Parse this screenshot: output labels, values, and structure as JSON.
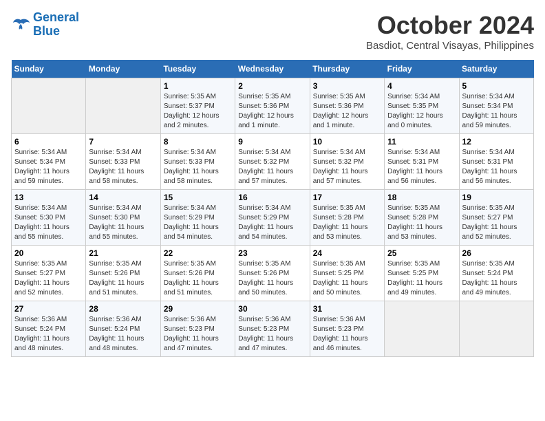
{
  "logo": {
    "text1": "General",
    "text2": "Blue"
  },
  "title": "October 2024",
  "location": "Basdiot, Central Visayas, Philippines",
  "headers": [
    "Sunday",
    "Monday",
    "Tuesday",
    "Wednesday",
    "Thursday",
    "Friday",
    "Saturday"
  ],
  "weeks": [
    [
      {
        "day": "",
        "info": ""
      },
      {
        "day": "",
        "info": ""
      },
      {
        "day": "1",
        "info": "Sunrise: 5:35 AM\nSunset: 5:37 PM\nDaylight: 12 hours\nand 2 minutes."
      },
      {
        "day": "2",
        "info": "Sunrise: 5:35 AM\nSunset: 5:36 PM\nDaylight: 12 hours\nand 1 minute."
      },
      {
        "day": "3",
        "info": "Sunrise: 5:35 AM\nSunset: 5:36 PM\nDaylight: 12 hours\nand 1 minute."
      },
      {
        "day": "4",
        "info": "Sunrise: 5:34 AM\nSunset: 5:35 PM\nDaylight: 12 hours\nand 0 minutes."
      },
      {
        "day": "5",
        "info": "Sunrise: 5:34 AM\nSunset: 5:34 PM\nDaylight: 11 hours\nand 59 minutes."
      }
    ],
    [
      {
        "day": "6",
        "info": "Sunrise: 5:34 AM\nSunset: 5:34 PM\nDaylight: 11 hours\nand 59 minutes."
      },
      {
        "day": "7",
        "info": "Sunrise: 5:34 AM\nSunset: 5:33 PM\nDaylight: 11 hours\nand 58 minutes."
      },
      {
        "day": "8",
        "info": "Sunrise: 5:34 AM\nSunset: 5:33 PM\nDaylight: 11 hours\nand 58 minutes."
      },
      {
        "day": "9",
        "info": "Sunrise: 5:34 AM\nSunset: 5:32 PM\nDaylight: 11 hours\nand 57 minutes."
      },
      {
        "day": "10",
        "info": "Sunrise: 5:34 AM\nSunset: 5:32 PM\nDaylight: 11 hours\nand 57 minutes."
      },
      {
        "day": "11",
        "info": "Sunrise: 5:34 AM\nSunset: 5:31 PM\nDaylight: 11 hours\nand 56 minutes."
      },
      {
        "day": "12",
        "info": "Sunrise: 5:34 AM\nSunset: 5:31 PM\nDaylight: 11 hours\nand 56 minutes."
      }
    ],
    [
      {
        "day": "13",
        "info": "Sunrise: 5:34 AM\nSunset: 5:30 PM\nDaylight: 11 hours\nand 55 minutes."
      },
      {
        "day": "14",
        "info": "Sunrise: 5:34 AM\nSunset: 5:30 PM\nDaylight: 11 hours\nand 55 minutes."
      },
      {
        "day": "15",
        "info": "Sunrise: 5:34 AM\nSunset: 5:29 PM\nDaylight: 11 hours\nand 54 minutes."
      },
      {
        "day": "16",
        "info": "Sunrise: 5:34 AM\nSunset: 5:29 PM\nDaylight: 11 hours\nand 54 minutes."
      },
      {
        "day": "17",
        "info": "Sunrise: 5:35 AM\nSunset: 5:28 PM\nDaylight: 11 hours\nand 53 minutes."
      },
      {
        "day": "18",
        "info": "Sunrise: 5:35 AM\nSunset: 5:28 PM\nDaylight: 11 hours\nand 53 minutes."
      },
      {
        "day": "19",
        "info": "Sunrise: 5:35 AM\nSunset: 5:27 PM\nDaylight: 11 hours\nand 52 minutes."
      }
    ],
    [
      {
        "day": "20",
        "info": "Sunrise: 5:35 AM\nSunset: 5:27 PM\nDaylight: 11 hours\nand 52 minutes."
      },
      {
        "day": "21",
        "info": "Sunrise: 5:35 AM\nSunset: 5:26 PM\nDaylight: 11 hours\nand 51 minutes."
      },
      {
        "day": "22",
        "info": "Sunrise: 5:35 AM\nSunset: 5:26 PM\nDaylight: 11 hours\nand 51 minutes."
      },
      {
        "day": "23",
        "info": "Sunrise: 5:35 AM\nSunset: 5:26 PM\nDaylight: 11 hours\nand 50 minutes."
      },
      {
        "day": "24",
        "info": "Sunrise: 5:35 AM\nSunset: 5:25 PM\nDaylight: 11 hours\nand 50 minutes."
      },
      {
        "day": "25",
        "info": "Sunrise: 5:35 AM\nSunset: 5:25 PM\nDaylight: 11 hours\nand 49 minutes."
      },
      {
        "day": "26",
        "info": "Sunrise: 5:35 AM\nSunset: 5:24 PM\nDaylight: 11 hours\nand 49 minutes."
      }
    ],
    [
      {
        "day": "27",
        "info": "Sunrise: 5:36 AM\nSunset: 5:24 PM\nDaylight: 11 hours\nand 48 minutes."
      },
      {
        "day": "28",
        "info": "Sunrise: 5:36 AM\nSunset: 5:24 PM\nDaylight: 11 hours\nand 48 minutes."
      },
      {
        "day": "29",
        "info": "Sunrise: 5:36 AM\nSunset: 5:23 PM\nDaylight: 11 hours\nand 47 minutes."
      },
      {
        "day": "30",
        "info": "Sunrise: 5:36 AM\nSunset: 5:23 PM\nDaylight: 11 hours\nand 47 minutes."
      },
      {
        "day": "31",
        "info": "Sunrise: 5:36 AM\nSunset: 5:23 PM\nDaylight: 11 hours\nand 46 minutes."
      },
      {
        "day": "",
        "info": ""
      },
      {
        "day": "",
        "info": ""
      }
    ]
  ]
}
